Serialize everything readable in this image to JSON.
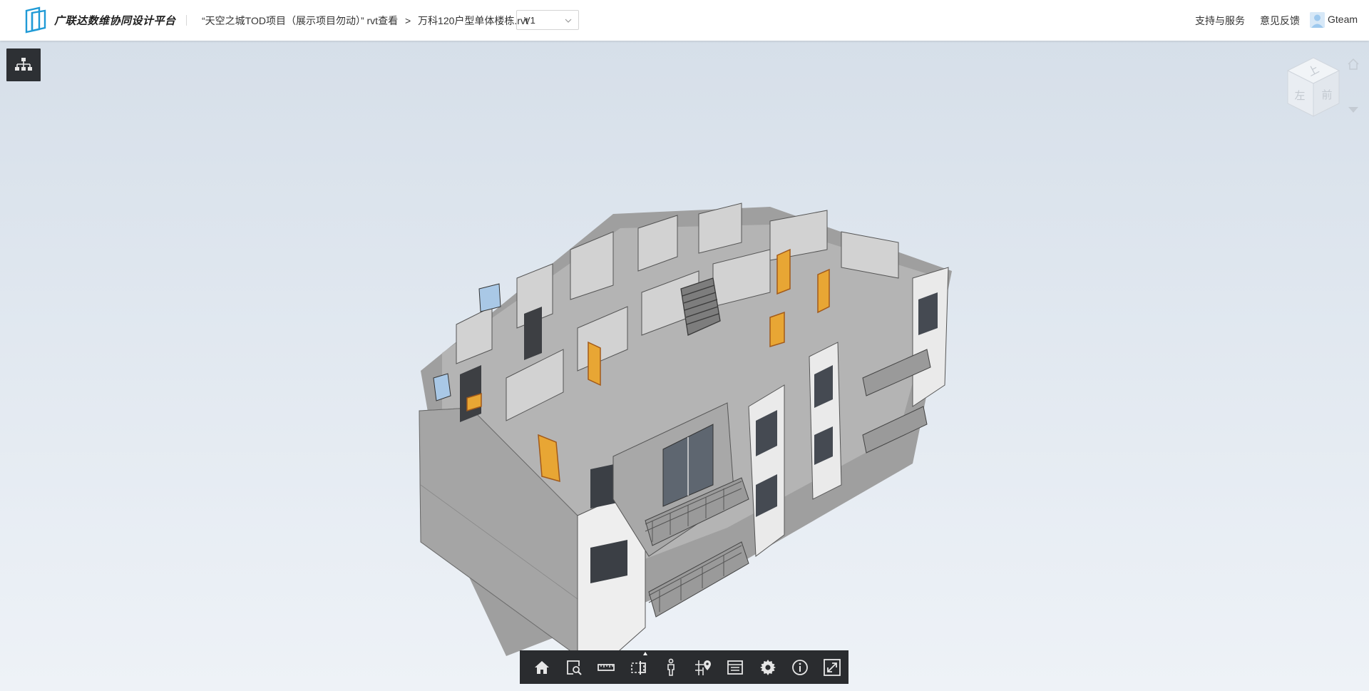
{
  "header": {
    "brand": "广联达数维协同设计平台",
    "breadcrumb": {
      "project": "“天空之城TOD项目（展示项目勿动）”",
      "view": "rvt查看",
      "separator": ">",
      "file": "万科120户型单体楼栋.rvt"
    },
    "version": {
      "selected": "V1"
    },
    "links": {
      "support": "支持与服务",
      "feedback": "意见反馈"
    },
    "user": "Gteam"
  },
  "viewcube": {
    "faces": {
      "top": "上",
      "left": "左",
      "front": "前"
    }
  },
  "toolbar": {
    "tools": [
      {
        "name": "home-view",
        "icon": "home-icon"
      },
      {
        "name": "zoom-window",
        "icon": "zoom-box-icon"
      },
      {
        "name": "measure",
        "icon": "ruler-icon"
      },
      {
        "name": "section-box",
        "icon": "section-icon"
      },
      {
        "name": "walkthrough",
        "icon": "person-icon"
      },
      {
        "name": "locate",
        "icon": "map-pin-icon"
      },
      {
        "name": "properties",
        "icon": "list-icon"
      },
      {
        "name": "settings",
        "icon": "gear-icon"
      },
      {
        "name": "info",
        "icon": "info-icon"
      },
      {
        "name": "fullscreen",
        "icon": "fullscreen-icon"
      }
    ]
  },
  "colors": {
    "accent": "#1f9ad6",
    "toolbar_bg": "#2a2c2f",
    "door_orange": "#e8a634"
  }
}
